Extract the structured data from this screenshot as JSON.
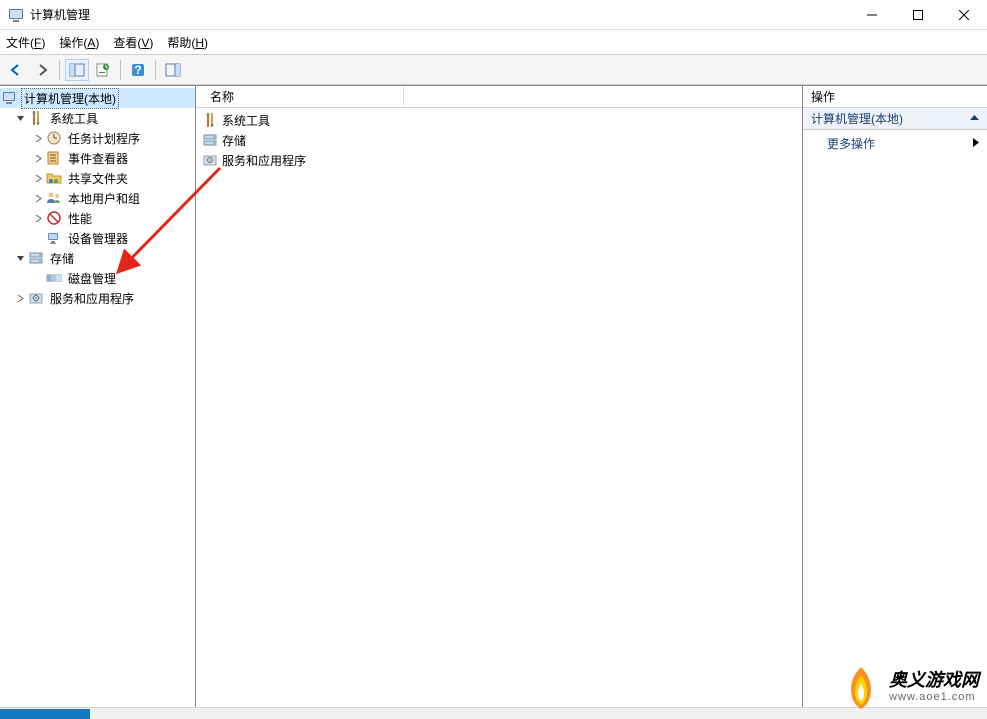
{
  "window": {
    "title": "计算机管理"
  },
  "menu": {
    "file": "文件(F)",
    "action": "操作(A)",
    "view": "查看(V)",
    "help": "帮助(H)"
  },
  "tree": {
    "root": "计算机管理(本地)",
    "system_tools": "系统工具",
    "task_scheduler": "任务计划程序",
    "event_viewer": "事件查看器",
    "shared_folders": "共享文件夹",
    "local_users": "本地用户和组",
    "performance": "性能",
    "device_manager": "设备管理器",
    "storage": "存储",
    "disk_management": "磁盘管理",
    "services_apps": "服务和应用程序"
  },
  "list": {
    "header": "名称",
    "items": [
      {
        "name": "系统工具",
        "icon": "system-tools-icon"
      },
      {
        "name": "存储",
        "icon": "storage-icon"
      },
      {
        "name": "服务和应用程序",
        "icon": "services-apps-icon"
      }
    ]
  },
  "actions": {
    "header": "操作",
    "group": "计算机管理(本地)",
    "more": "更多操作"
  },
  "watermark": {
    "cn": "奥义游戏网",
    "url": "www.aoe1.com"
  }
}
